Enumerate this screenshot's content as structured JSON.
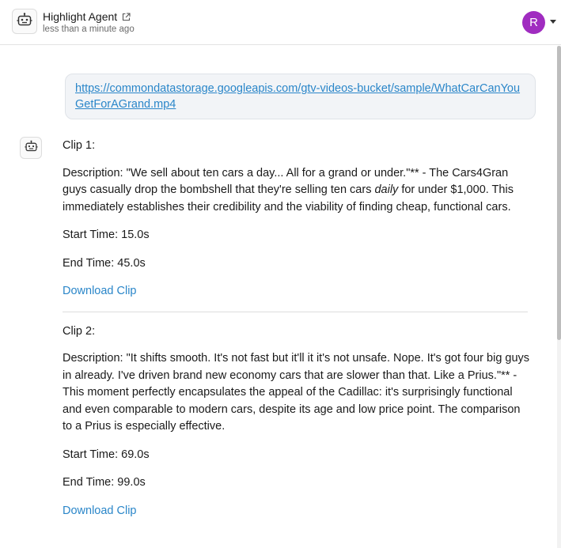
{
  "header": {
    "agent_name": "Highlight Agent",
    "agent_time": "less than a minute ago",
    "user_initial": "R",
    "user_avatar_color": "#a02cc0"
  },
  "url_bubble": {
    "url": "https://commondatastorage.googleapis.com/gtv-videos-bucket/sample/WhatCarCanYouGetForAGrand.mp4"
  },
  "clips": [
    {
      "title": "Clip 1:",
      "description_before": "Description: \"We sell about ten cars a day... All for a grand or under.\"** - The Cars4Gran guys casually drop the bombshell that they're selling ten cars ",
      "description_emphasis": "daily",
      "description_after": " for under $1,000. This immediately establishes their credibility and the viability of finding cheap, functional cars.",
      "start_time": "Start Time: 15.0s",
      "end_time": "End Time: 45.0s",
      "download_label": "Download Clip"
    },
    {
      "title": "Clip 2:",
      "description_before": "Description: \"It shifts smooth. It's not fast but it'll it it's not unsafe. Nope. It's got four big guys in already. I've driven brand new economy cars that are slower than that. Like a Prius.\"** - This moment perfectly encapsulates the appeal of the Cadillac: it's surprisingly functional and even comparable to modern cars, despite its age and low price point. The comparison to a Prius is especially effective.",
      "description_emphasis": "",
      "description_after": "",
      "start_time": "Start Time: 69.0s",
      "end_time": "End Time: 99.0s",
      "download_label": "Download Clip"
    }
  ],
  "colors": {
    "link": "#2a86c9",
    "bubble_bg": "#f2f4f7"
  },
  "icons": {
    "agent": "robot-icon",
    "external": "external-link-icon",
    "caret": "chevron-down-icon"
  }
}
